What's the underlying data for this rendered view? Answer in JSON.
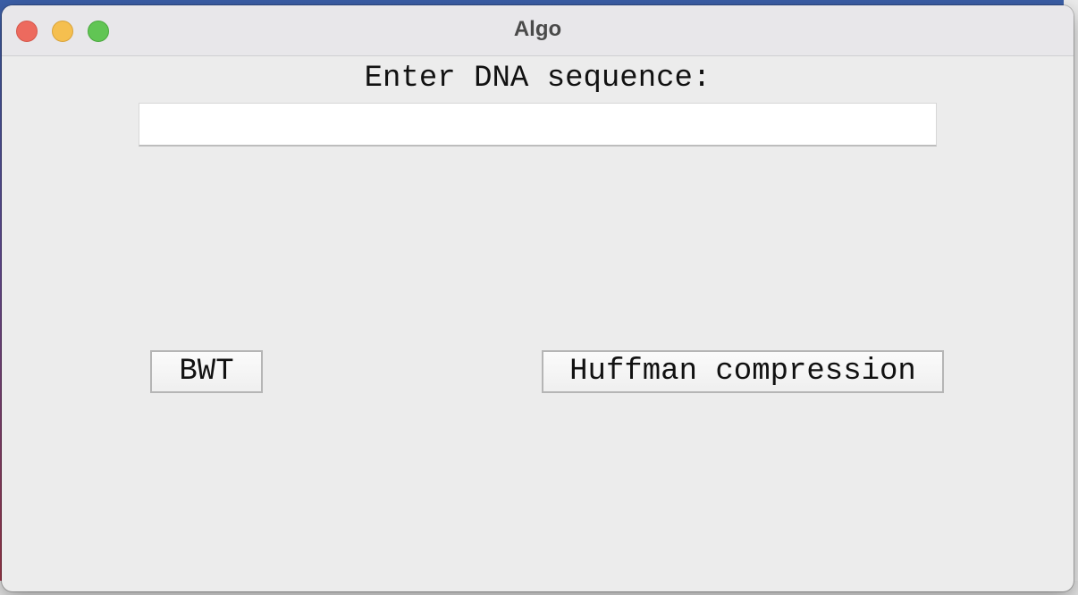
{
  "window": {
    "title": "Algo"
  },
  "form": {
    "prompt_label": "Enter DNA sequence:",
    "dna_input_value": "",
    "dna_input_placeholder": ""
  },
  "actions": {
    "bwt_label": "BWT",
    "huffman_label": "Huffman compression"
  },
  "icons": {
    "close": "close-icon",
    "minimize": "minimize-icon",
    "maximize": "maximize-icon"
  },
  "colors": {
    "close": "#ed6a5e",
    "minimize": "#f5bf4f",
    "maximize": "#61c554",
    "window_bg": "#ececec"
  }
}
